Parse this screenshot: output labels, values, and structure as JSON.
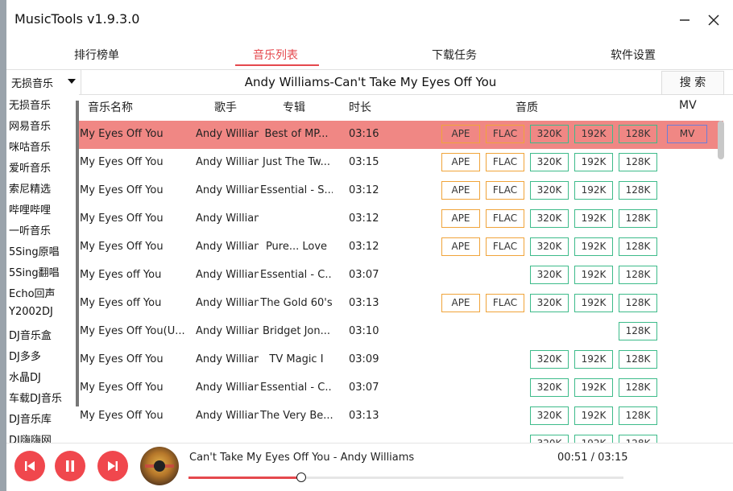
{
  "app": {
    "title": "MusicTools v1.9.3.0"
  },
  "tabs": [
    "排行榜单",
    "音乐列表",
    "下载任务",
    "软件设置"
  ],
  "active_tab": 1,
  "search": {
    "source": "无损音乐",
    "query": "Andy Williams-Can't Take My Eyes Off You",
    "button_label": "搜 索"
  },
  "columns": {
    "name": "音乐名称",
    "artist": "歌手",
    "album": "专辑",
    "duration": "时长",
    "quality": "音质",
    "mv": "MV"
  },
  "rows": [
    {
      "name": "Can't Take My Eyes Off You",
      "artist": "Andy Williams",
      "album": "Best of MP...",
      "duration": "03:16",
      "ape": "APE",
      "flac": "FLAC",
      "q320": "320K",
      "q192": "192K",
      "q128": "128K",
      "mv": "MV",
      "selected": true
    },
    {
      "name": "Can't Take My Eyes Off You",
      "artist": "Andy Williams",
      "album": "Just The Tw...",
      "duration": "03:15",
      "ape": "APE",
      "flac": "FLAC",
      "q320": "320K",
      "q192": "192K",
      "q128": "128K"
    },
    {
      "name": "Can't Take My Eyes Off You",
      "artist": "Andy Williams",
      "album": "Essential - S...",
      "duration": "03:12",
      "ape": "APE",
      "flac": "FLAC",
      "q320": "320K",
      "q192": "192K",
      "q128": "128K"
    },
    {
      "name": "Can't Take My Eyes Off You",
      "artist": "Andy Williams",
      "album": "",
      "duration": "03:12",
      "ape": "APE",
      "flac": "FLAC",
      "q320": "320K",
      "q192": "192K",
      "q128": "128K"
    },
    {
      "name": "Can't Take My Eyes Off You",
      "artist": "Andy Williams",
      "album": "Pure... Love",
      "duration": "03:12",
      "ape": "APE",
      "flac": "FLAC",
      "q320": "320K",
      "q192": "192K",
      "q128": "128K"
    },
    {
      "name": "Can't Take My Eyes off You",
      "artist": "Andy Williams",
      "album": "Essential - C...",
      "duration": "03:07",
      "q320": "320K",
      "q192": "192K",
      "q128": "128K"
    },
    {
      "name": "Can't Take My Eyes off You",
      "artist": "Andy Williams",
      "album": "The Gold 60's",
      "duration": "03:13",
      "ape": "APE",
      "flac": "FLAC",
      "q320": "320K",
      "q192": "192K",
      "q128": "128K"
    },
    {
      "name": "Can't Take My Eyes Off You(U...",
      "artist": "Andy Williams",
      "album": "Bridget Jon...",
      "duration": "03:10",
      "q128": "128K"
    },
    {
      "name": "Can't Take My Eyes Off You",
      "artist": "Andy Williams",
      "album": "TV Magic I",
      "duration": "03:09",
      "q320": "320K",
      "q192": "192K",
      "q128": "128K"
    },
    {
      "name": "Can't Take My Eyes Off You",
      "artist": "Andy Williams",
      "album": "Essential - C...",
      "duration": "03:07",
      "q320": "320K",
      "q192": "192K",
      "q128": "128K"
    },
    {
      "name": "Can't Take My Eyes Off You",
      "artist": "Andy Williams",
      "album": "The Very Be...",
      "duration": "03:13",
      "q320": "320K",
      "q192": "192K",
      "q128": "128K"
    },
    {
      "name": "",
      "artist": "",
      "album": "",
      "duration": "",
      "q320": "320K",
      "q192": "192K",
      "q128": "128K"
    }
  ],
  "sources": [
    "无损音乐",
    "网易音乐",
    "咪咕音乐",
    "爱听音乐",
    "索尼精选",
    "哔哩哔哩",
    "一听音乐",
    "5Sing原唱",
    "5Sing翻唱",
    "Echo回声",
    "Y2002DJ",
    "DJ音乐盒",
    "DJ多多",
    "水晶DJ",
    "车载DJ音乐",
    "DJ音乐库",
    "DJ嗨嗨网"
  ],
  "player": {
    "now_playing": "Can't Take My Eyes Off You - Andy Williams",
    "elapsed": "00:51",
    "total": "03:15",
    "time_text": "00:51 / 03:15",
    "progress": 0.26
  },
  "colors": {
    "accent": "#e5484d",
    "selected_row": "#f08784",
    "lossless_border": "#f0a43a",
    "lossy_border": "#3dbb8a",
    "mv_border": "#6b7ed8"
  }
}
